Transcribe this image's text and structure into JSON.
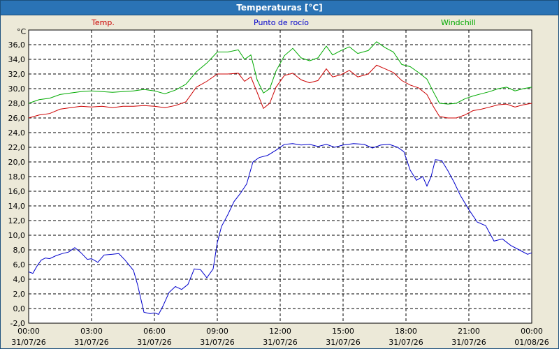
{
  "window": {
    "title": "Temperaturas [°C]"
  },
  "chart_data": {
    "type": "line",
    "unit_label": "°C",
    "ylim": [
      -2,
      38
    ],
    "xlim": [
      0,
      24
    ],
    "grid": true,
    "legend_placement": "top",
    "y_ticks": [
      "36,0",
      "34,0",
      "32,0",
      "30,0",
      "28,0",
      "26,0",
      "24,0",
      "22,0",
      "20,0",
      "18,0",
      "16,0",
      "14,0",
      "12,0",
      "10,0",
      "8,0",
      "6,0",
      "4,0",
      "2,0",
      "0,0",
      "-2,0"
    ],
    "x_ticks": [
      {
        "time": "00:00",
        "date": "31/07/26"
      },
      {
        "time": "03:00",
        "date": "31/07/26"
      },
      {
        "time": "06:00",
        "date": "31/07/26"
      },
      {
        "time": "09:00",
        "date": "31/07/26"
      },
      {
        "time": "12:00",
        "date": "31/07/26"
      },
      {
        "time": "15:00",
        "date": "31/07/26"
      },
      {
        "time": "18:00",
        "date": "31/07/26"
      },
      {
        "time": "21:00",
        "date": "31/07/26"
      },
      {
        "time": "00:00",
        "date": "01/08/26"
      }
    ],
    "series": [
      {
        "name": "Temp.",
        "color": "#cc0000",
        "points": [
          [
            0,
            26.0
          ],
          [
            0.5,
            26.4
          ],
          [
            1.0,
            26.6
          ],
          [
            1.5,
            27.2
          ],
          [
            2.0,
            27.4
          ],
          [
            2.5,
            27.6
          ],
          [
            3.0,
            27.5
          ],
          [
            3.5,
            27.6
          ],
          [
            4.0,
            27.4
          ],
          [
            4.5,
            27.6
          ],
          [
            5.0,
            27.6
          ],
          [
            5.5,
            27.7
          ],
          [
            6.0,
            27.6
          ],
          [
            6.5,
            27.4
          ],
          [
            7.0,
            27.7
          ],
          [
            7.5,
            28.2
          ],
          [
            8.0,
            30.2
          ],
          [
            8.5,
            31.0
          ],
          [
            9.0,
            32.0
          ],
          [
            9.5,
            32.0
          ],
          [
            10.0,
            32.1
          ],
          [
            10.3,
            31.0
          ],
          [
            10.6,
            31.6
          ],
          [
            10.9,
            29.5
          ],
          [
            11.2,
            27.3
          ],
          [
            11.5,
            28.0
          ],
          [
            11.8,
            30.2
          ],
          [
            12.2,
            31.8
          ],
          [
            12.6,
            32.1
          ],
          [
            13.0,
            31.2
          ],
          [
            13.4,
            30.8
          ],
          [
            13.8,
            31.1
          ],
          [
            14.2,
            32.7
          ],
          [
            14.5,
            31.6
          ],
          [
            14.9,
            31.9
          ],
          [
            15.3,
            32.5
          ],
          [
            15.7,
            31.6
          ],
          [
            16.2,
            32.0
          ],
          [
            16.6,
            33.2
          ],
          [
            17.0,
            32.7
          ],
          [
            17.4,
            32.2
          ],
          [
            17.8,
            31.1
          ],
          [
            18.2,
            30.5
          ],
          [
            18.6,
            30.1
          ],
          [
            19.0,
            29.2
          ],
          [
            19.3,
            27.6
          ],
          [
            19.6,
            26.2
          ],
          [
            20.0,
            26.0
          ],
          [
            20.4,
            26.0
          ],
          [
            20.8,
            26.4
          ],
          [
            21.2,
            27.0
          ],
          [
            21.6,
            27.2
          ],
          [
            22.0,
            27.5
          ],
          [
            22.4,
            27.8
          ],
          [
            22.8,
            27.9
          ],
          [
            23.2,
            27.5
          ],
          [
            23.6,
            27.8
          ],
          [
            24.0,
            28.0
          ]
        ]
      },
      {
        "name": "Punto de rocío",
        "color": "#0000cc",
        "points": [
          [
            0,
            5.0
          ],
          [
            0.2,
            4.8
          ],
          [
            0.4,
            5.8
          ],
          [
            0.6,
            6.6
          ],
          [
            0.8,
            6.9
          ],
          [
            1.0,
            6.8
          ],
          [
            1.3,
            7.2
          ],
          [
            1.6,
            7.5
          ],
          [
            1.9,
            7.7
          ],
          [
            2.2,
            8.3
          ],
          [
            2.5,
            7.6
          ],
          [
            2.8,
            6.7
          ],
          [
            3.0,
            6.8
          ],
          [
            3.3,
            6.3
          ],
          [
            3.6,
            7.3
          ],
          [
            4.0,
            7.4
          ],
          [
            4.3,
            7.5
          ],
          [
            4.6,
            6.6
          ],
          [
            5.0,
            5.2
          ],
          [
            5.2,
            3.2
          ],
          [
            5.5,
            -0.5
          ],
          [
            5.8,
            -0.7
          ],
          [
            6.0,
            -0.6
          ],
          [
            6.2,
            -0.8
          ],
          [
            6.4,
            0.3
          ],
          [
            6.7,
            2.2
          ],
          [
            7.0,
            3.0
          ],
          [
            7.3,
            2.6
          ],
          [
            7.6,
            3.3
          ],
          [
            7.9,
            5.4
          ],
          [
            8.2,
            5.3
          ],
          [
            8.5,
            4.2
          ],
          [
            8.8,
            5.4
          ],
          [
            9.0,
            9.0
          ],
          [
            9.2,
            11.2
          ],
          [
            9.5,
            12.8
          ],
          [
            9.8,
            14.6
          ],
          [
            10.1,
            15.7
          ],
          [
            10.4,
            17.0
          ],
          [
            10.7,
            20.0
          ],
          [
            11.0,
            20.6
          ],
          [
            11.4,
            20.9
          ],
          [
            11.8,
            21.6
          ],
          [
            12.2,
            22.4
          ],
          [
            12.6,
            22.5
          ],
          [
            13.0,
            22.3
          ],
          [
            13.4,
            22.4
          ],
          [
            13.8,
            22.1
          ],
          [
            14.2,
            22.4
          ],
          [
            14.6,
            22.0
          ],
          [
            15.0,
            22.3
          ],
          [
            15.5,
            22.5
          ],
          [
            16.0,
            22.4
          ],
          [
            16.4,
            21.9
          ],
          [
            16.8,
            22.3
          ],
          [
            17.2,
            22.4
          ],
          [
            17.6,
            22.0
          ],
          [
            17.9,
            21.4
          ],
          [
            18.2,
            18.9
          ],
          [
            18.5,
            17.5
          ],
          [
            18.8,
            18.0
          ],
          [
            19.0,
            16.7
          ],
          [
            19.2,
            18.0
          ],
          [
            19.4,
            20.3
          ],
          [
            19.7,
            20.2
          ],
          [
            20.0,
            18.8
          ],
          [
            20.3,
            17.2
          ],
          [
            20.6,
            15.4
          ],
          [
            21.0,
            13.5
          ],
          [
            21.4,
            11.8
          ],
          [
            21.8,
            11.3
          ],
          [
            22.2,
            9.2
          ],
          [
            22.6,
            9.5
          ],
          [
            23.0,
            8.6
          ],
          [
            23.4,
            8.0
          ],
          [
            23.8,
            7.4
          ],
          [
            24.0,
            7.6
          ]
        ]
      },
      {
        "name": "Windchill",
        "color": "#00aa00",
        "points": [
          [
            0,
            28.0
          ],
          [
            0.5,
            28.5
          ],
          [
            1.0,
            28.7
          ],
          [
            1.5,
            29.2
          ],
          [
            2.0,
            29.4
          ],
          [
            2.5,
            29.6
          ],
          [
            3.0,
            29.7
          ],
          [
            3.5,
            29.6
          ],
          [
            4.0,
            29.5
          ],
          [
            4.5,
            29.6
          ],
          [
            5.0,
            29.7
          ],
          [
            5.5,
            29.9
          ],
          [
            6.0,
            29.7
          ],
          [
            6.5,
            29.3
          ],
          [
            7.0,
            29.8
          ],
          [
            7.5,
            30.6
          ],
          [
            8.0,
            32.3
          ],
          [
            8.5,
            33.5
          ],
          [
            9.0,
            35.0
          ],
          [
            9.5,
            35.0
          ],
          [
            10.0,
            35.3
          ],
          [
            10.3,
            34.0
          ],
          [
            10.6,
            34.6
          ],
          [
            10.9,
            31.2
          ],
          [
            11.2,
            29.4
          ],
          [
            11.5,
            30.0
          ],
          [
            11.8,
            32.4
          ],
          [
            12.2,
            34.5
          ],
          [
            12.6,
            35.5
          ],
          [
            13.0,
            34.2
          ],
          [
            13.4,
            33.8
          ],
          [
            13.8,
            34.2
          ],
          [
            14.2,
            35.8
          ],
          [
            14.5,
            34.6
          ],
          [
            14.9,
            35.2
          ],
          [
            15.3,
            35.7
          ],
          [
            15.7,
            34.8
          ],
          [
            16.2,
            35.2
          ],
          [
            16.6,
            36.4
          ],
          [
            17.0,
            35.6
          ],
          [
            17.4,
            35.0
          ],
          [
            17.8,
            33.3
          ],
          [
            18.2,
            33.0
          ],
          [
            18.6,
            32.2
          ],
          [
            19.0,
            31.3
          ],
          [
            19.3,
            29.6
          ],
          [
            19.6,
            28.0
          ],
          [
            20.0,
            27.9
          ],
          [
            20.4,
            28.0
          ],
          [
            20.8,
            28.6
          ],
          [
            21.2,
            29.0
          ],
          [
            21.6,
            29.3
          ],
          [
            22.0,
            29.6
          ],
          [
            22.4,
            30.0
          ],
          [
            22.8,
            30.2
          ],
          [
            23.2,
            29.7
          ],
          [
            23.6,
            30.0
          ],
          [
            24.0,
            30.2
          ]
        ]
      }
    ]
  }
}
